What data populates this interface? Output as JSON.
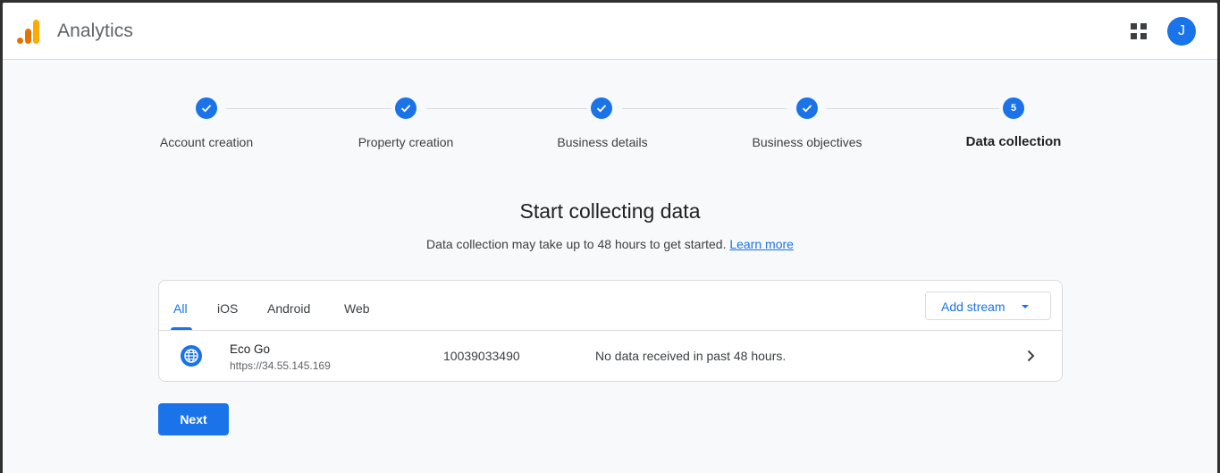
{
  "app": {
    "title": "Analytics",
    "avatar_initial": "J"
  },
  "stepper": {
    "steps": [
      {
        "label": "Account creation",
        "state": "done"
      },
      {
        "label": "Property creation",
        "state": "done"
      },
      {
        "label": "Business details",
        "state": "done"
      },
      {
        "label": "Business objectives",
        "state": "done"
      },
      {
        "label": "Data collection",
        "state": "active",
        "number": "5"
      }
    ]
  },
  "main": {
    "headline": "Start collecting data",
    "subline": "Data collection may take up to 48 hours to get started.",
    "learn_more": "Learn more"
  },
  "streams": {
    "tabs": [
      {
        "label": "All",
        "active": true
      },
      {
        "label": "iOS",
        "active": false
      },
      {
        "label": "Android",
        "active": false
      },
      {
        "label": "Web",
        "active": false
      }
    ],
    "add_stream_label": "Add stream",
    "rows": [
      {
        "icon": "globe-icon",
        "name": "Eco Go",
        "url": "https://34.55.145.169",
        "id": "10039033490",
        "status": "No data received in past 48 hours."
      }
    ]
  },
  "footer": {
    "next_label": "Next"
  },
  "colors": {
    "accent": "#1a73e8",
    "logo_orange": "#f9ab00",
    "logo_dark_orange": "#e37400"
  }
}
